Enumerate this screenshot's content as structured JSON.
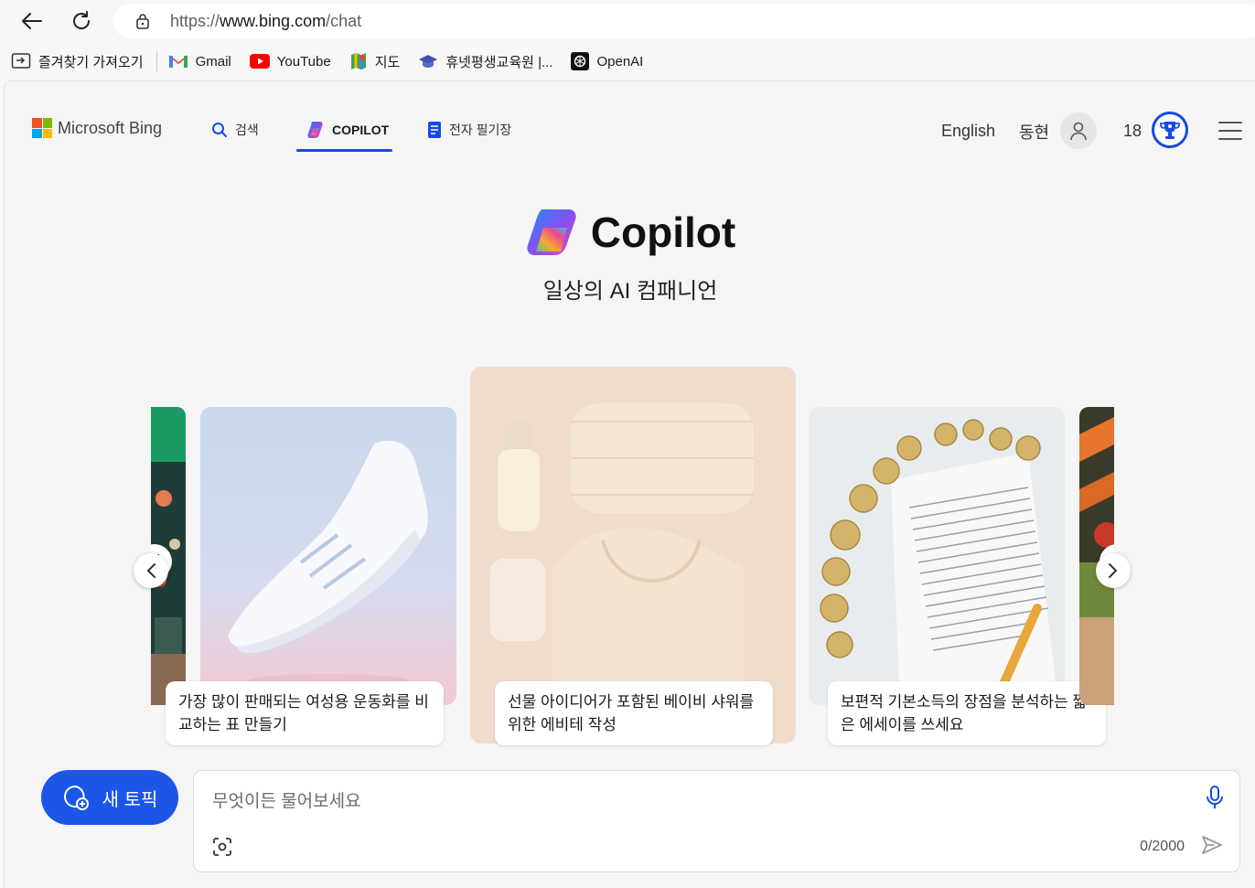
{
  "browser": {
    "url_prefix": "https://",
    "url_host": "www.bing.com",
    "url_path": "/chat",
    "bookmarks": [
      {
        "label": "즐겨찾기 가져오기",
        "icon": "import-favorites-icon"
      },
      {
        "label": "Gmail",
        "icon": "gmail-icon"
      },
      {
        "label": "YouTube",
        "icon": "youtube-icon"
      },
      {
        "label": "지도",
        "icon": "maps-icon"
      },
      {
        "label": "휴넷평생교육원 |...",
        "icon": "graduation-cap-icon"
      },
      {
        "label": "OpenAI",
        "icon": "openai-icon"
      }
    ]
  },
  "nav": {
    "logo": "Microsoft Bing",
    "tabs": [
      {
        "label": "검색",
        "icon": "search-icon"
      },
      {
        "label": "COPILOT",
        "icon": "copilot-icon"
      },
      {
        "label": "전자 필기장",
        "icon": "notebook-icon"
      }
    ],
    "language": "English",
    "user_name": "동현",
    "reward_count": "18"
  },
  "hero": {
    "title": "Copilot",
    "subtitle": "일상의 AI 컴패니언"
  },
  "cards": [
    {
      "caption": "가장 많이 판매되는 여성용 운동화를 비교하는 표 만들기"
    },
    {
      "caption": "선물 아이디어가 포함된 베이비 샤워를 위한 에비테 작성"
    },
    {
      "caption": "보편적 기본소득의 장점을 분석하는 짧은 에세이를 쓰세요"
    }
  ],
  "composer": {
    "new_topic": "새 토픽",
    "placeholder": "무엇이든 물어보세요",
    "counter": "0/2000"
  },
  "colors": {
    "accent": "#174ae4",
    "new_topic_bg": "#1b56e8"
  }
}
